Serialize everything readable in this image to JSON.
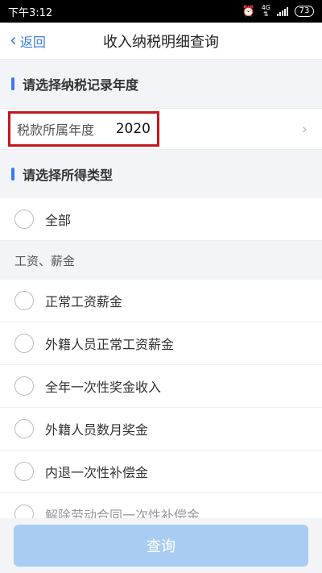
{
  "status_bar": {
    "time": "下午3:12",
    "network": "4G",
    "battery": "73"
  },
  "nav": {
    "back_label": "返回",
    "title": "收入纳税明细查询"
  },
  "year_section": {
    "title": "请选择纳税记录年度",
    "field_label": "税款所属年度",
    "field_value": "2020"
  },
  "type_section": {
    "title": "请选择所得类型",
    "all_option": "全部",
    "group_label": "工资、薪金",
    "options": [
      "正常工资薪金",
      "外籍人员正常工资薪金",
      "全年一次性奖金收入",
      "外籍人员数月奖金",
      "内退一次性补偿金",
      "解除劳动合同一次性补偿金"
    ]
  },
  "query_button": "查询",
  "colors": {
    "accent": "#3a7af0",
    "highlight_box": "#c8161e",
    "button_disabled": "#a9cdf2"
  }
}
